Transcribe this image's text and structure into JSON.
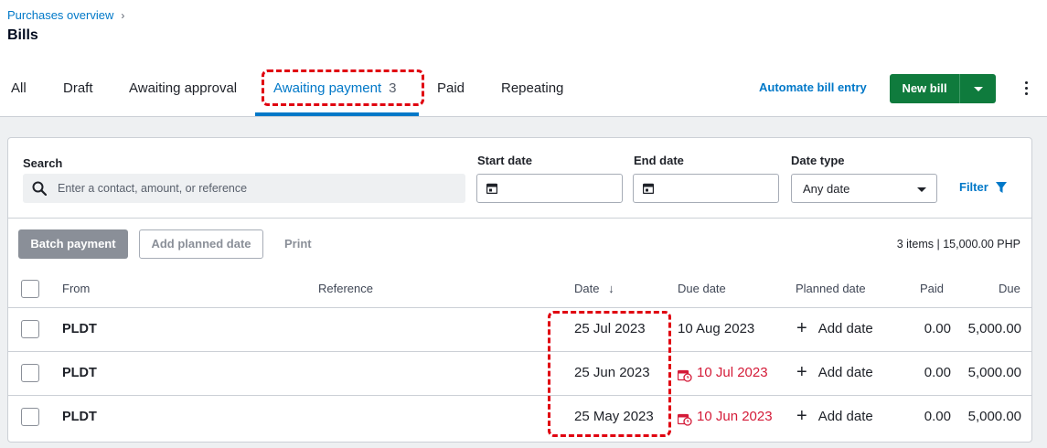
{
  "breadcrumb": {
    "label": "Purchases overview",
    "chevron": "›"
  },
  "page_title": "Bills",
  "tabs": [
    {
      "label": "All"
    },
    {
      "label": "Draft"
    },
    {
      "label": "Awaiting approval"
    },
    {
      "label": "Awaiting payment",
      "count": "3",
      "active": true
    },
    {
      "label": "Paid"
    },
    {
      "label": "Repeating"
    }
  ],
  "actions": {
    "automate_label": "Automate bill entry",
    "new_bill_label": "New bill"
  },
  "filters": {
    "search_label": "Search",
    "search_placeholder": "Enter a contact, amount, or reference",
    "start_date_label": "Start date",
    "end_date_label": "End date",
    "date_type_label": "Date type",
    "date_type_value": "Any date",
    "filter_label": "Filter"
  },
  "toolbar": {
    "batch_payment": "Batch payment",
    "add_planned_date": "Add planned date",
    "print": "Print",
    "summary": "3 items | 15,000.00 PHP"
  },
  "table": {
    "headers": {
      "from": "From",
      "reference": "Reference",
      "date": "Date",
      "date_sort_icon": "↓",
      "due_date": "Due date",
      "planned_date": "Planned date",
      "paid": "Paid",
      "due": "Due"
    },
    "rows": [
      {
        "from": "PLDT",
        "reference": "",
        "date": "25 Jul 2023",
        "due_date": "10 Aug 2023",
        "overdue": false,
        "planned": "Add date",
        "paid": "0.00",
        "due": "5,000.00"
      },
      {
        "from": "PLDT",
        "reference": "",
        "date": "25 Jun 2023",
        "due_date": "10 Jul 2023",
        "overdue": true,
        "planned": "Add date",
        "paid": "0.00",
        "due": "5,000.00"
      },
      {
        "from": "PLDT",
        "reference": "",
        "date": "25 May 2023",
        "due_date": "10 Jun 2023",
        "overdue": true,
        "planned": "Add date",
        "paid": "0.00",
        "due": "5,000.00"
      }
    ]
  },
  "colors": {
    "accent": "#0078c8",
    "primary_button": "#0f7b3d",
    "overdue": "#d41b38",
    "highlight": "#e00010"
  }
}
